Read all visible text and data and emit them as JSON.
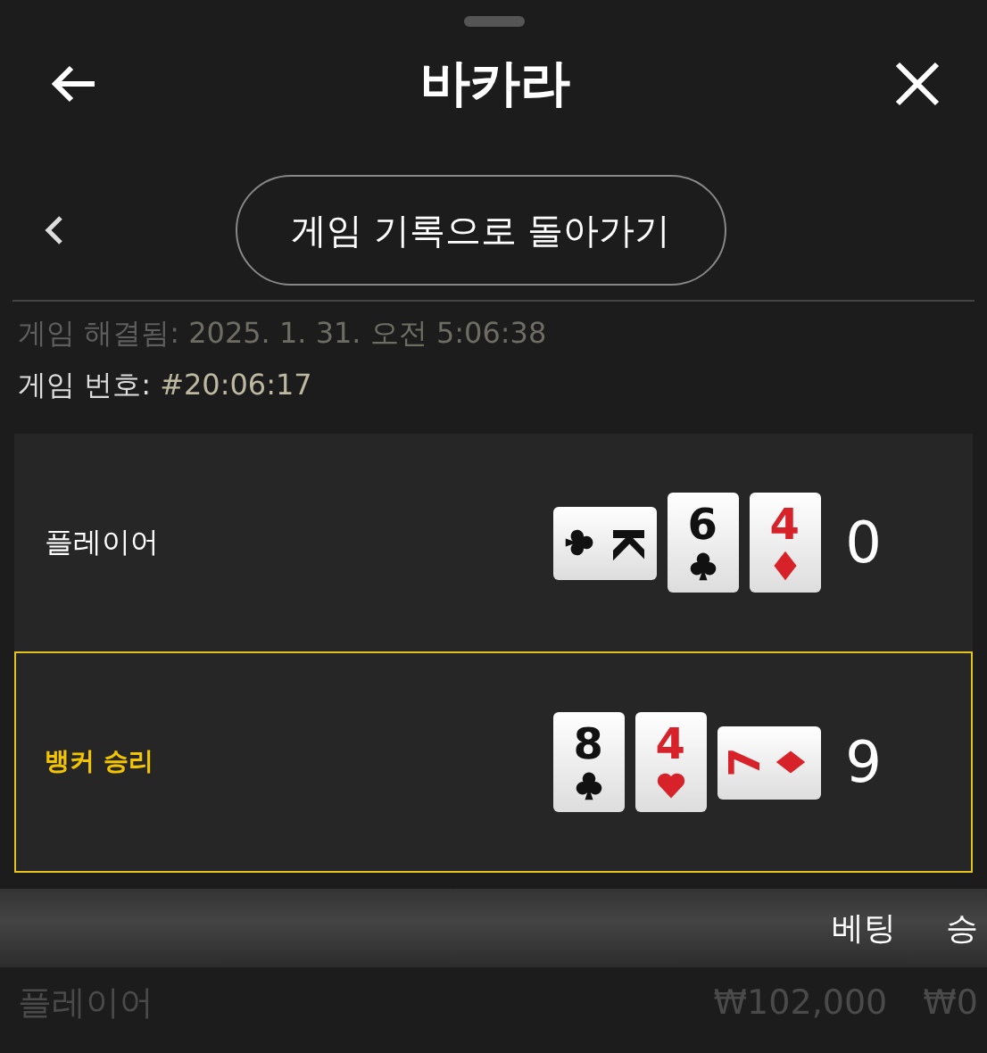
{
  "header": {
    "title": "바카라"
  },
  "nav": {
    "button": "게임 기록으로 돌아가기"
  },
  "info": [
    {
      "kind": "dim",
      "label": "게임 해결됨:",
      "value": "2025. 1. 31. 오전 5:06:38"
    },
    {
      "kind": "normal",
      "label": "게임 번호:",
      "value": "#20:06:17"
    }
  ],
  "hands": [
    {
      "label": "플레이어",
      "winner": false,
      "score": "0",
      "cards": [
        {
          "rank": "K",
          "kind": "clubs",
          "rotated_cw": true,
          "rotated_ccw": false
        },
        {
          "rank": "6",
          "kind": "clubs",
          "rotated_cw": false,
          "rotated_ccw": false
        },
        {
          "rank": "4",
          "kind": "diamonds",
          "rotated_cw": false,
          "rotated_ccw": false
        }
      ]
    },
    {
      "label": "뱅커 승리",
      "winner": true,
      "score": "9",
      "cards": [
        {
          "rank": "8",
          "kind": "clubs",
          "rotated_cw": false,
          "rotated_ccw": false
        },
        {
          "rank": "4",
          "kind": "hearts",
          "rotated_cw": false,
          "rotated_ccw": false
        },
        {
          "rank": "7",
          "kind": "diamonds",
          "rotated_cw": false,
          "rotated_ccw": true
        }
      ]
    }
  ],
  "table": {
    "columns": [
      "",
      "베팅",
      "승"
    ],
    "rows": [
      {
        "cells": [
          "플레이어",
          "₩102,000",
          "₩0"
        ]
      }
    ]
  }
}
